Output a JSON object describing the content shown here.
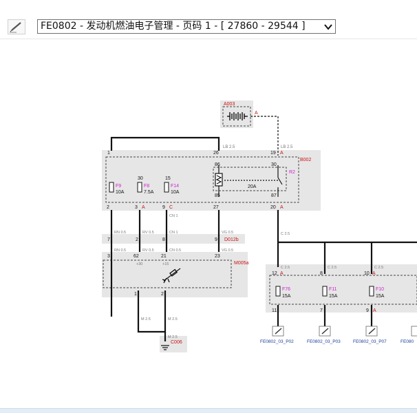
{
  "toolbar": {
    "page_selector_value": "FE0802 - 发动机燃油电子管理 - 页码 1 - [ 27860 - 29544 ]",
    "pen_icon": "pen-icon",
    "dropdown_icon": "chevron-down-icon"
  },
  "colors": {
    "wire": "#1a1a1a",
    "module_fill": "#e6e6e6",
    "red_label": "#cc1111",
    "pink_label": "#cc22cc",
    "blue_link": "#1a3d9a"
  },
  "diagram": {
    "a003": {
      "id": "A003",
      "pin": "A"
    },
    "b002": {
      "id": "B002",
      "top_pins": [
        "1",
        "26",
        "19",
        "A"
      ],
      "wire_labels_top": [
        "LB 2.5",
        "LB 2.5"
      ],
      "fuses": [
        {
          "id": "F9",
          "rating": "10A",
          "circuit": ""
        },
        {
          "id": "F8",
          "rating": "7.5A",
          "circuit": "30"
        },
        {
          "id": "F14",
          "rating": "10A",
          "circuit": "15"
        }
      ],
      "relay": {
        "id": "R2",
        "rating": "20A",
        "pins": [
          "86",
          "30",
          "85",
          "87"
        ]
      },
      "bottom_pins": [
        "2",
        "3",
        "A",
        "9",
        "C",
        "27",
        "20",
        "A"
      ]
    },
    "wires_mid": [
      "RN 0.5",
      "RV 0.5",
      "CN 1",
      "VG 0.5"
    ],
    "d012b": {
      "id": "D012b",
      "pins": [
        "7",
        "2",
        "8",
        "9"
      ]
    },
    "wires_mid2": [
      "RN 0.5",
      "RV 0.5",
      "CN 0.5",
      "VG 0.5"
    ],
    "m005a": {
      "id": "M005a",
      "pins": [
        "3",
        "62",
        "21",
        "23"
      ],
      "terms": [
        "+30",
        "+15"
      ],
      "bottom_pins": [
        "1",
        "2"
      ]
    },
    "ground_wires": [
      "M 2.5",
      "M 2.5",
      "M 2.5"
    ],
    "c006": {
      "id": "C006",
      "icon": "ground-icon"
    },
    "right_bus": {
      "wire": "C 2.5",
      "branches": [
        "C 2.5",
        "C 2.5",
        "C 2.5"
      ]
    },
    "right_box": {
      "top_pins": [
        "12",
        "A",
        "8",
        "10",
        "A"
      ],
      "fuses": [
        {
          "id": "F76",
          "rating": "15A"
        },
        {
          "id": "F11",
          "rating": "15A"
        },
        {
          "id": "F10",
          "rating": "15A"
        }
      ],
      "bottom_pins": [
        "11",
        "7",
        "9",
        "A"
      ]
    },
    "links": [
      "FE0802_03_P02",
      "FE0802_03_P03",
      "FE0802_03_P07",
      "FE080"
    ],
    "link_icon": "pen-link-icon"
  }
}
